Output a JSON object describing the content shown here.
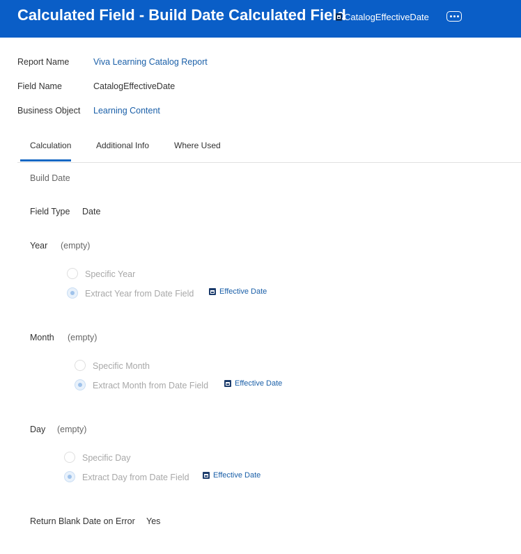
{
  "header": {
    "title": "Calculated Field - Build Date Calculated Field",
    "field_chip": "CatalogEffectiveDate",
    "field_icon": "calendar-field-icon",
    "more_icon": "more-options-icon",
    "background": "#0a5ec7"
  },
  "details": {
    "report_name_label": "Report Name",
    "report_name_value": "Viva Learning Catalog Report",
    "field_name_label": "Field Name",
    "field_name_value": "CatalogEffectiveDate",
    "business_object_label": "Business Object",
    "business_object_value": "Learning Content"
  },
  "tabs": [
    {
      "label": "Calculation",
      "active": true
    },
    {
      "label": "Additional Info",
      "active": false
    },
    {
      "label": "Where Used",
      "active": false
    }
  ],
  "calculation": {
    "function_name": "Build Date",
    "field_type_label": "Field Type",
    "field_type_value": "Date",
    "year": {
      "label": "Year",
      "value": "(empty)",
      "option_specific": "Specific Year",
      "option_extract": "Extract Year from Date Field",
      "selected": "extract",
      "field": "Effective Date"
    },
    "month": {
      "label": "Month",
      "value": "(empty)",
      "option_specific": "Specific Month",
      "option_extract": "Extract Month from Date Field",
      "selected": "extract",
      "field": "Effective Date"
    },
    "day": {
      "label": "Day",
      "value": "(empty)",
      "option_specific": "Specific Day",
      "option_extract": "Extract Day from Date Field",
      "selected": "extract",
      "field": "Effective Date"
    },
    "return_blank_label": "Return Blank Date on Error",
    "return_blank_value": "Yes"
  },
  "colors": {
    "accent": "#1768c4",
    "link": "#1a5fa8"
  }
}
